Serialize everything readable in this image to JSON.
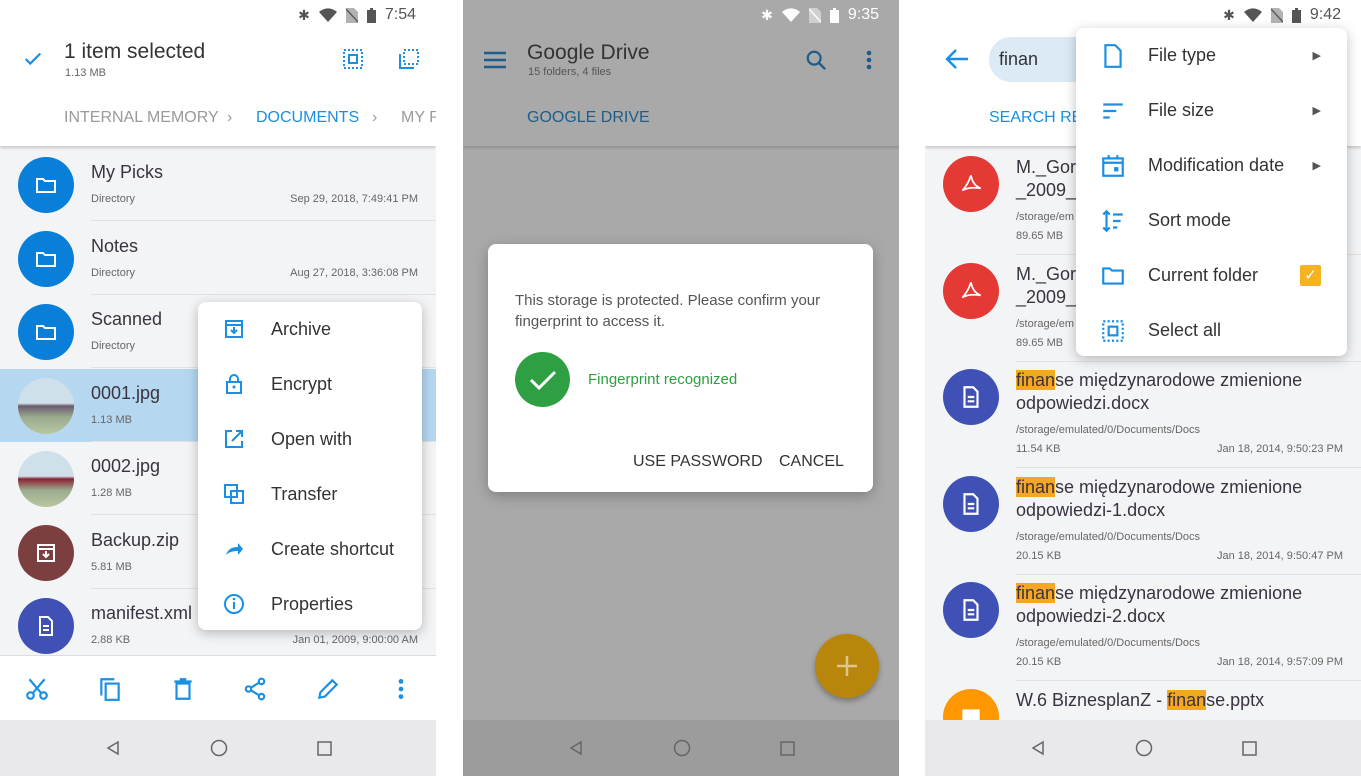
{
  "colors": {
    "accent": "#1a8fe3",
    "folder": "#0a7fd9",
    "pdf": "#e53935",
    "doc": "#3f51b5",
    "zip": "#7b3f3f",
    "highlight": "#f5a623",
    "success": "#2ea043"
  },
  "panel1": {
    "status": {
      "time": "7:54"
    },
    "header": {
      "title": "1 item selected",
      "subtitle": "1.13 MB"
    },
    "breadcrumb": [
      "INTERNAL MEMORY",
      "DOCUMENTS",
      "MY P"
    ],
    "files": [
      {
        "name": "My Picks",
        "type": "Directory",
        "date": "Sep 29, 2018, 7:49:41 PM",
        "icon": "folder-icon"
      },
      {
        "name": "Notes",
        "type": "Directory",
        "date": "Aug 27, 2018, 3:36:08 PM",
        "icon": "folder-icon"
      },
      {
        "name": "Scanned",
        "type": "Directory",
        "date": "",
        "icon": "folder-icon"
      },
      {
        "name": "0001.jpg",
        "type": "1.13 MB",
        "date": "",
        "icon": "image-thumbnail",
        "selected": true
      },
      {
        "name": "0002.jpg",
        "type": "1.28 MB",
        "date": "",
        "icon": "image-thumbnail"
      },
      {
        "name": "Backup.zip",
        "type": "5.81 MB",
        "date": "",
        "icon": "archive-icon"
      },
      {
        "name": "manifest.xml",
        "type": "2.88 KB",
        "date": "Jan 01, 2009, 9:00:00 AM",
        "icon": "document-icon"
      }
    ],
    "context_menu": [
      {
        "label": "Archive",
        "icon": "archive-icon"
      },
      {
        "label": "Encrypt",
        "icon": "lock-icon"
      },
      {
        "label": "Open with",
        "icon": "open-external-icon"
      },
      {
        "label": "Transfer",
        "icon": "transfer-icon"
      },
      {
        "label": "Create shortcut",
        "icon": "shortcut-icon"
      },
      {
        "label": "Properties",
        "icon": "info-icon"
      }
    ],
    "toolbar": [
      "cut-icon",
      "copy-icon",
      "delete-icon",
      "share-icon",
      "edit-icon",
      "more-icon"
    ]
  },
  "panel2": {
    "status": {
      "time": "9:35"
    },
    "header": {
      "title": "Google Drive",
      "subtitle": "15 folders, 4 files"
    },
    "tab": "GOOGLE DRIVE",
    "dialog": {
      "message": "This storage is protected. Please confirm your fingerprint to access it.",
      "status": "Fingerprint recognized",
      "use_password": "USE PASSWORD",
      "cancel": "CANCEL"
    }
  },
  "panel3": {
    "status": {
      "time": "9:42"
    },
    "search": {
      "value": "finan"
    },
    "tab": "SEARCH RES",
    "filter_menu": [
      {
        "label": "File type",
        "icon": "file-icon",
        "submenu": true
      },
      {
        "label": "File size",
        "icon": "file-size-icon",
        "submenu": true
      },
      {
        "label": "Modification date",
        "icon": "calendar-icon",
        "submenu": true
      },
      {
        "label": "Sort mode",
        "icon": "sort-icon"
      },
      {
        "label": "Current folder",
        "icon": "folder-outline-icon",
        "checked": true
      },
      {
        "label": "Select all",
        "icon": "select-all-icon"
      }
    ],
    "results": [
      {
        "pre": "M._Gor",
        "hl": "",
        "post": "",
        "line2": "_2009_",
        "path": "/storage/em",
        "size": "89.65 MB",
        "date": "",
        "icon": "pdf-icon"
      },
      {
        "pre": "M._Gor",
        "hl": "",
        "post": "",
        "line2": "_2009_",
        "path": "/storage/em",
        "size": "89.65 MB",
        "date": "",
        "icon": "pdf-icon"
      },
      {
        "pre": "",
        "hl": "finan",
        "post": "se międzynarodowe zmienione",
        "line2": "odpowiedzi.docx",
        "path": "/storage/emulated/0/Documents/Docs",
        "size": "11.54 KB",
        "date": "Jan 18, 2014, 9:50:23 PM",
        "icon": "document-icon"
      },
      {
        "pre": "",
        "hl": "finan",
        "post": "se międzynarodowe zmienione",
        "line2": "odpowiedzi-1.docx",
        "path": "/storage/emulated/0/Documents/Docs",
        "size": "20.15 KB",
        "date": "Jan 18, 2014, 9:50:47 PM",
        "icon": "document-icon"
      },
      {
        "pre": "",
        "hl": "finan",
        "post": "se międzynarodowe zmienione",
        "line2": "odpowiedzi-2.docx",
        "path": "/storage/emulated/0/Documents/Docs",
        "size": "20.15 KB",
        "date": "Jan 18, 2014, 9:57:09 PM",
        "icon": "document-icon"
      },
      {
        "pre": "W.6 BiznesplanZ - ",
        "hl": "finan",
        "post": "se.pptx",
        "line2": "",
        "path": "",
        "size": "",
        "date": "",
        "icon": "presentation-icon"
      }
    ]
  }
}
